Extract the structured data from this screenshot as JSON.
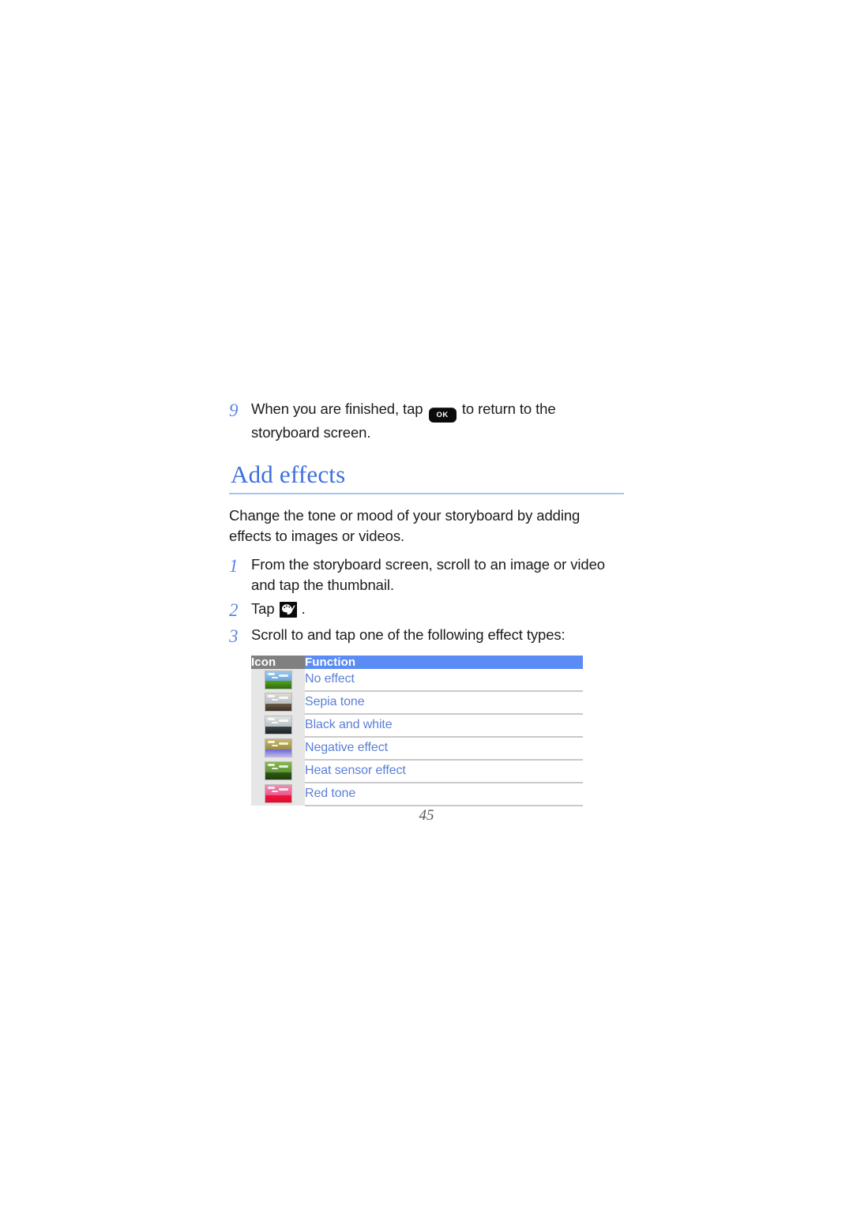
{
  "document": {
    "page_number": "45"
  },
  "steps_top": [
    {
      "number": "9",
      "text_before": "When you are finished, tap",
      "icon_label": "OK",
      "text_after": "to return to the storyboard screen."
    }
  ],
  "section": {
    "heading": "Add effects",
    "intro": "Change the tone or mood of your storyboard by adding effects to images or videos."
  },
  "steps": [
    {
      "number": "1",
      "text": "From the storyboard screen, scroll to an image or video and tap the thumbnail."
    },
    {
      "number": "2",
      "text_before": "Tap",
      "icon_name": "palette-icon",
      "text_after": "."
    },
    {
      "number": "3",
      "text": "Scroll to and tap one of the following effect types:"
    }
  ],
  "effects_table": {
    "headers": {
      "icon": "Icon",
      "function": "Function"
    },
    "header_icon_bg": "#808080",
    "header_function_bg": "#5b8bf5",
    "row_text_color": "#5b7fd8",
    "rows": [
      {
        "function": "No effect",
        "thumb_name": "thumbnail-no-effect",
        "sky": "#6ba6de",
        "sky2": "#9cc8ea",
        "ground": "#57a21c",
        "ground2": "#2f6b10"
      },
      {
        "function": "Sepia tone",
        "thumb_name": "thumbnail-sepia-tone",
        "sky": "#b9bfc4",
        "sky2": "#dedad2",
        "ground": "#6b5a46",
        "ground2": "#3b3026"
      },
      {
        "function": "Black and white",
        "thumb_name": "thumbnail-black-and-white",
        "sky": "#b7c0c6",
        "sky2": "#e0e2e2",
        "ground": "#3a4449",
        "ground2": "#1c2226"
      },
      {
        "function": "Negative effect",
        "thumb_name": "thumbnail-negative-effect",
        "sky": "#9a8c3f",
        "sky2": "#c9b96a",
        "ground": "#6d66d8",
        "ground2": "#bcb6ef"
      },
      {
        "function": "Heat sensor effect",
        "thumb_name": "thumbnail-heat-sensor-effect",
        "sky": "#5e9134",
        "sky2": "#86b84e",
        "ground": "#2f5c16",
        "ground2": "#1d3d0c"
      },
      {
        "function": "Red tone",
        "thumb_name": "thumbnail-red-tone",
        "sky": "#e8568c",
        "sky2": "#f28fb0",
        "ground": "#f4143f",
        "ground2": "#e00b30"
      }
    ]
  }
}
